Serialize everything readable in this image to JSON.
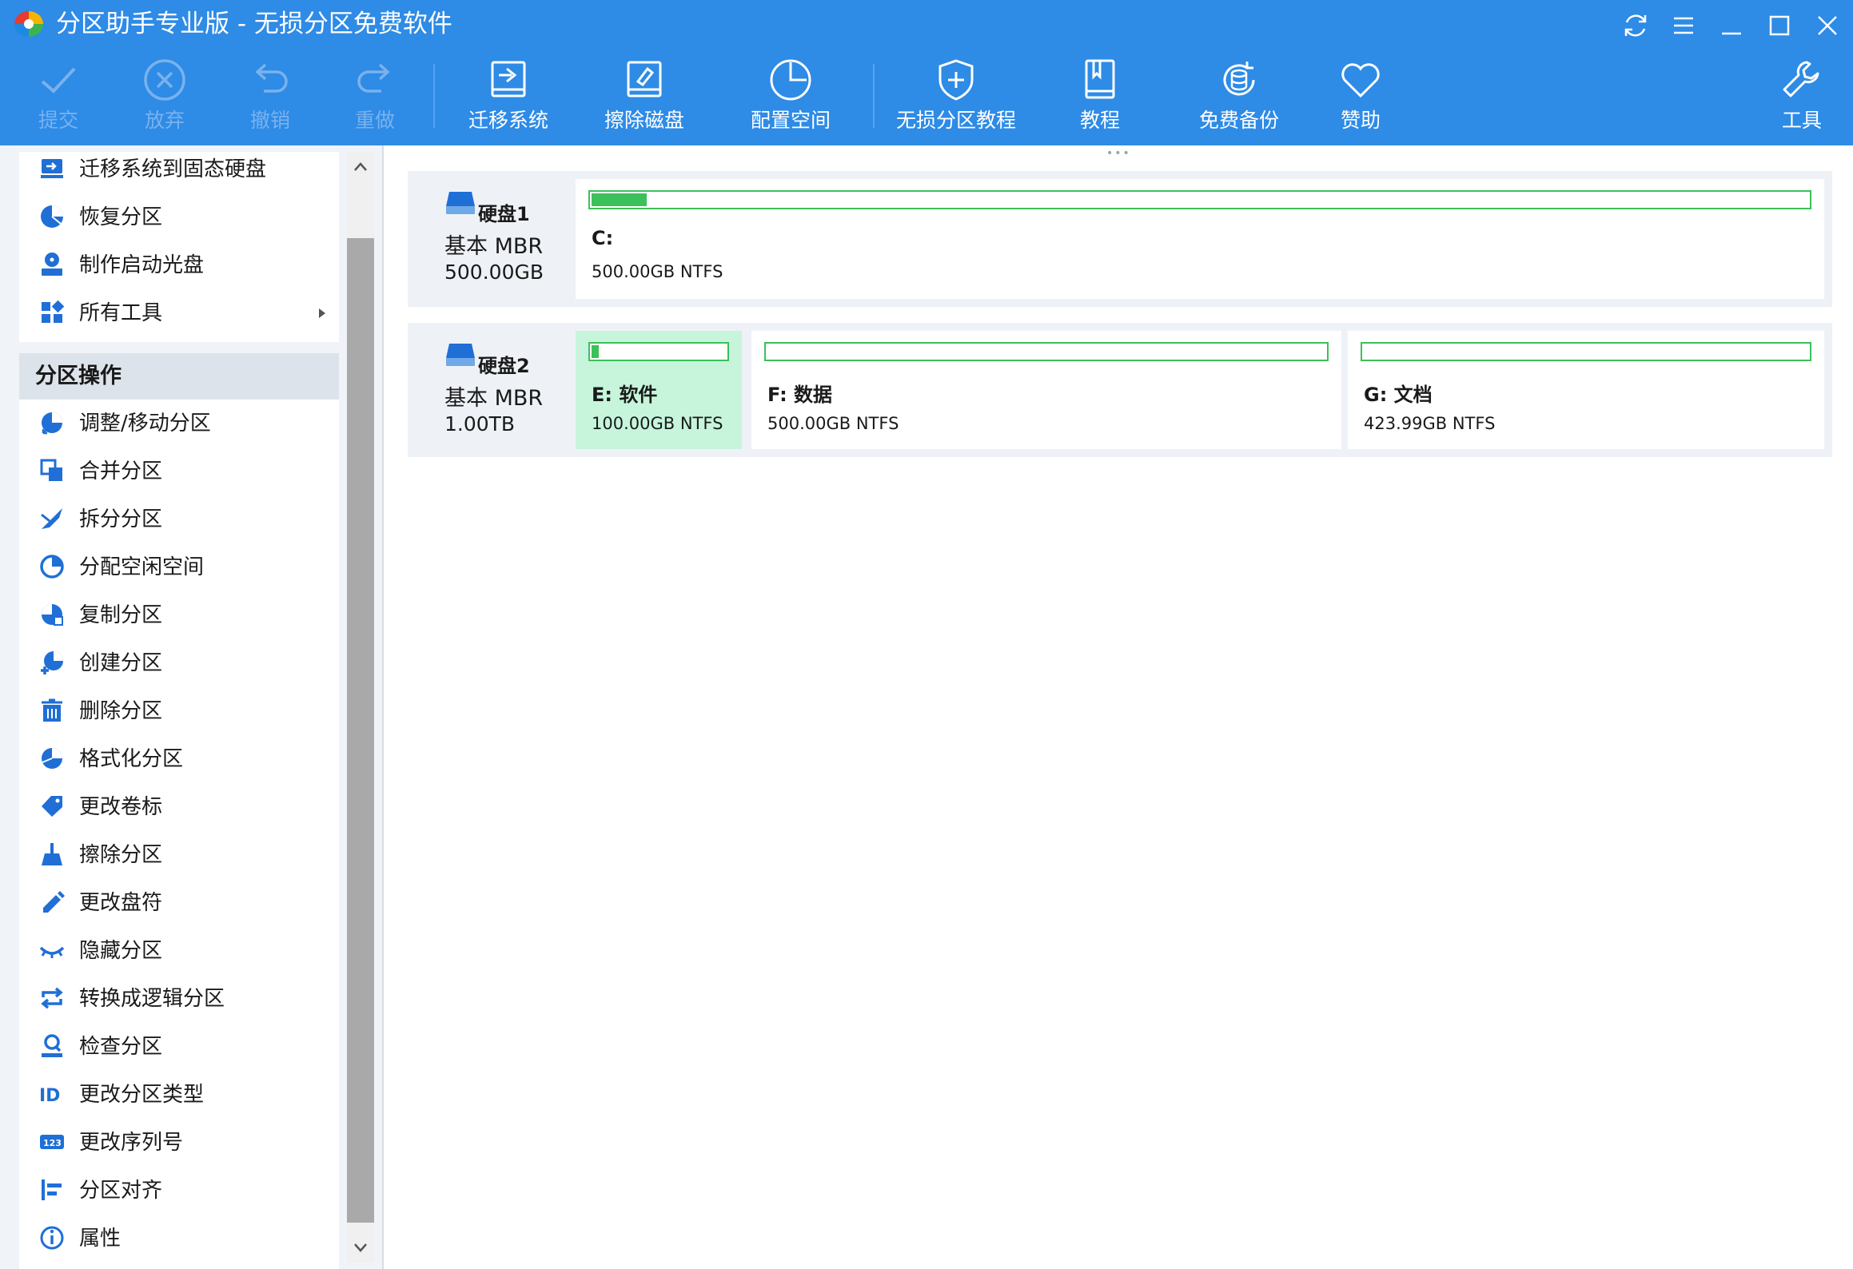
{
  "window": {
    "title": "分区助手专业版 - 无损分区免费软件",
    "controls": [
      "refresh-icon",
      "menu-icon",
      "minimize-icon",
      "maximize-icon",
      "close-icon"
    ]
  },
  "toolbar": {
    "items": [
      {
        "label": "提交",
        "icon": "check-icon",
        "enabled": false
      },
      {
        "label": "放弃",
        "icon": "cancel-circle-icon",
        "enabled": false
      },
      {
        "label": "撤销",
        "icon": "undo-icon",
        "enabled": false
      },
      {
        "label": "重做",
        "icon": "redo-icon",
        "enabled": false
      },
      {
        "label": "迁移系统",
        "icon": "migrate-disk-icon",
        "enabled": true
      },
      {
        "label": "擦除磁盘",
        "icon": "wipe-disk-icon",
        "enabled": true
      },
      {
        "label": "配置空间",
        "icon": "pie-clock-icon",
        "enabled": true
      },
      {
        "label": "无损分区教程",
        "icon": "shield-plus-icon",
        "enabled": true
      },
      {
        "label": "教程",
        "icon": "book-icon",
        "enabled": true
      },
      {
        "label": "免费备份",
        "icon": "database-backup-icon",
        "enabled": true
      },
      {
        "label": "赞助",
        "icon": "heart-icon",
        "enabled": true
      },
      {
        "label": "工具",
        "icon": "wrench-icon",
        "enabled": true
      }
    ]
  },
  "sidebar": {
    "top_items": [
      {
        "label": "迁移系统到固态硬盘",
        "icon": "migrate-ssd-icon"
      },
      {
        "label": "恢复分区",
        "icon": "recover-partition-icon"
      },
      {
        "label": "制作启动光盘",
        "icon": "bootable-media-icon"
      },
      {
        "label": "所有工具",
        "icon": "all-tools-icon",
        "has_submenu": true
      }
    ],
    "section_title": "分区操作",
    "partition_ops": [
      {
        "label": "调整/移动分区",
        "icon": "resize-move-icon"
      },
      {
        "label": "合并分区",
        "icon": "merge-icon"
      },
      {
        "label": "拆分分区",
        "icon": "split-icon"
      },
      {
        "label": "分配空闲空间",
        "icon": "allocate-space-icon"
      },
      {
        "label": "复制分区",
        "icon": "copy-partition-icon"
      },
      {
        "label": "创建分区",
        "icon": "create-partition-icon"
      },
      {
        "label": "删除分区",
        "icon": "delete-icon"
      },
      {
        "label": "格式化分区",
        "icon": "format-icon"
      },
      {
        "label": "更改卷标",
        "icon": "label-tag-icon"
      },
      {
        "label": "擦除分区",
        "icon": "wipe-broom-icon"
      },
      {
        "label": "更改盘符",
        "icon": "pencil-icon"
      },
      {
        "label": "隐藏分区",
        "icon": "hide-eye-icon"
      },
      {
        "label": "转换成逻辑分区",
        "icon": "convert-icon"
      },
      {
        "label": "检查分区",
        "icon": "check-partition-icon"
      },
      {
        "label": "更改分区类型",
        "icon": "id-icon"
      },
      {
        "label": "更改序列号",
        "icon": "serial-number-icon"
      },
      {
        "label": "分区对齐",
        "icon": "align-icon"
      },
      {
        "label": "属性",
        "icon": "info-icon"
      }
    ]
  },
  "disks": [
    {
      "name": "硬盘1",
      "type": "基本 MBR",
      "size": "500.00GB",
      "partitions": [
        {
          "name": "C:",
          "info": "500.00GB NTFS",
          "used_fraction": 0.045,
          "selected": false
        }
      ]
    },
    {
      "name": "硬盘2",
      "type": "基本 MBR",
      "size": "1.00TB",
      "partitions": [
        {
          "name": "E: 软件",
          "info": "100.00GB NTFS",
          "used_fraction": 0.05,
          "selected": true
        },
        {
          "name": "F: 数据",
          "info": "500.00GB NTFS",
          "used_fraction": 0.0,
          "selected": false
        },
        {
          "name": "G: 文档",
          "info": "423.99GB NTFS",
          "used_fraction": 0.0,
          "selected": false
        }
      ]
    }
  ],
  "colors": {
    "titlebar": "#2e8be6",
    "partition_bar": "#3cc05a",
    "selected_partition": "#c6f5dc",
    "sidebar_icon": "#1f6fd6"
  }
}
